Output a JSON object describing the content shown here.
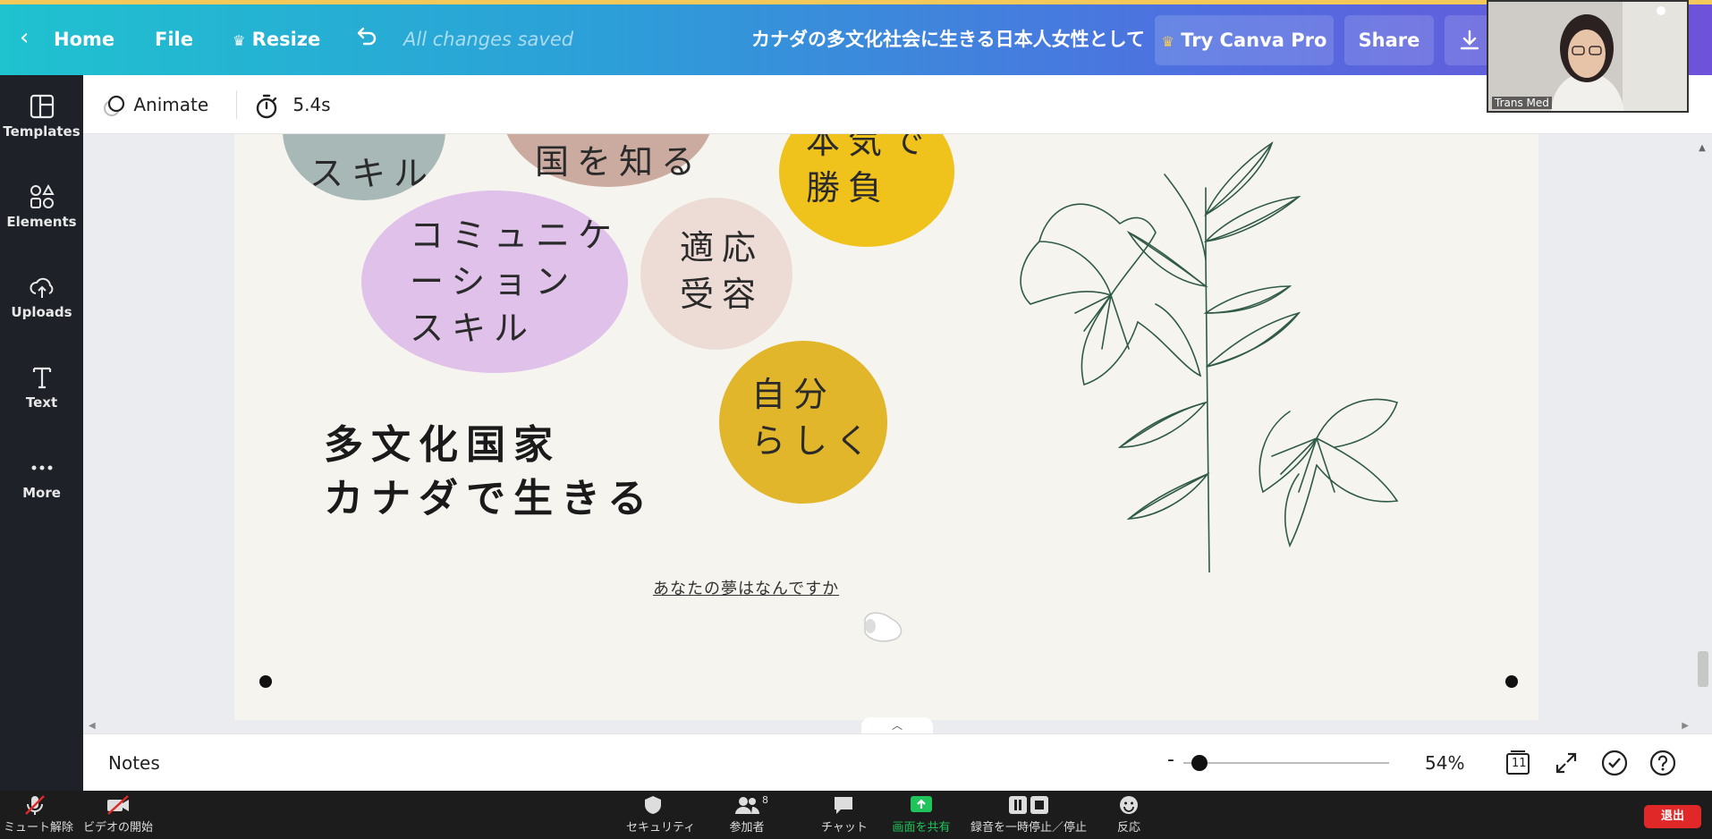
{
  "topbar": {
    "back_icon": "chevron-left-icon",
    "home": "Home",
    "file": "File",
    "resize": "Resize",
    "save_status": "All changes saved",
    "doc_title": "カナダの多文化社会に生きる日本人女性として",
    "try_pro": "Try Canva Pro",
    "share": "Share"
  },
  "sidebar": {
    "items": [
      {
        "label": "Templates",
        "icon": "templates-icon"
      },
      {
        "label": "Elements",
        "icon": "elements-icon"
      },
      {
        "label": "Uploads",
        "icon": "uploads-icon"
      },
      {
        "label": "Text",
        "icon": "text-icon"
      },
      {
        "label": "More",
        "icon": "more-icon"
      }
    ]
  },
  "toolbar2": {
    "animate": "Animate",
    "duration": "5.4s"
  },
  "slide": {
    "bubbles": [
      {
        "text": "スキル",
        "color": "#a8b8b6"
      },
      {
        "text": "国を知る",
        "color": "#cbaaa0"
      },
      {
        "text": "本気で\n勝負",
        "color": "#f0c21c"
      },
      {
        "text": "コミュニケ\nーション\nスキル",
        "color": "#dfc1ea"
      },
      {
        "text": "適応\n受容",
        "color": "#eddcd6"
      },
      {
        "text": "自分\nらしく",
        "color": "#e2b62a"
      }
    ],
    "heading": "多文化国家\nカナダで生きる",
    "dream_text": "あなたの夢はなんですか"
  },
  "bottombar": {
    "notes": "Notes",
    "zoom": "54%",
    "page_count": "11",
    "zoom_fraction": 0.08
  },
  "zoom_meeting": {
    "items": [
      {
        "label": "ミュート解除",
        "icon": "mic-muted-icon"
      },
      {
        "label": "ビデオの開始",
        "icon": "video-off-icon"
      },
      {
        "label": "セキュリティ",
        "icon": "shield-icon"
      },
      {
        "label": "参加者",
        "icon": "participants-icon",
        "count": "8"
      },
      {
        "label": "チャット",
        "icon": "chat-icon"
      },
      {
        "label": "画面を共有",
        "icon": "share-screen-icon"
      },
      {
        "label": "録音を一時停止／停止",
        "icon": "record-pause-icon"
      },
      {
        "label": "反応",
        "icon": "reaction-icon"
      }
    ],
    "exit": "退出",
    "webcam_name": "Trans Med"
  },
  "colors": {
    "share_screen_green": "#1fc45a",
    "exit_red": "#e02828"
  }
}
